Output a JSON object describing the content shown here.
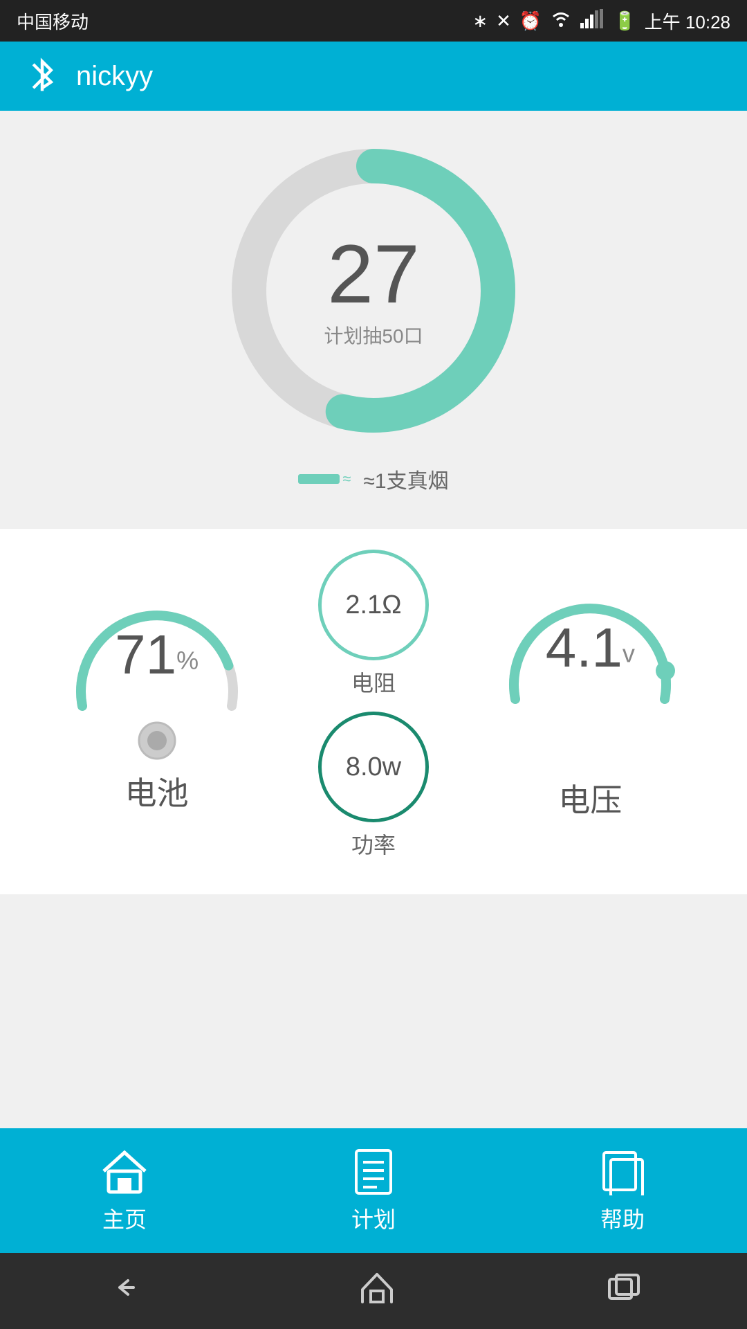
{
  "statusBar": {
    "carrier": "中国移动",
    "time": "10:28",
    "period": "上午"
  },
  "header": {
    "title": "nickyy",
    "bluetoothIcon": "bluetooth"
  },
  "donut": {
    "value": "27",
    "label": "计划抽50口",
    "percentage": 54,
    "trackColor": "#d8d8d8",
    "fillColor": "#6ecfba"
  },
  "cigarette": {
    "iconColor": "#6ecfba",
    "text": "≈1支真烟"
  },
  "battery": {
    "value": "71",
    "unit": "%",
    "label": "电池",
    "percentage": 71,
    "arcColor": "#6ecfba",
    "trackColor": "#d8d8d8"
  },
  "resistance": {
    "value": "2.1Ω",
    "label": "电阻"
  },
  "power": {
    "value": "8.0w",
    "label": "功率"
  },
  "voltage": {
    "value": "4.1",
    "unit": "v",
    "label": "电压",
    "percentage": 85,
    "arcColor": "#6ecfba",
    "trackColor": "#d8d8d8"
  },
  "nav": {
    "items": [
      {
        "id": "home",
        "label": "主页",
        "active": true
      },
      {
        "id": "plan",
        "label": "计划",
        "active": false
      },
      {
        "id": "help",
        "label": "帮助",
        "active": false
      }
    ]
  }
}
